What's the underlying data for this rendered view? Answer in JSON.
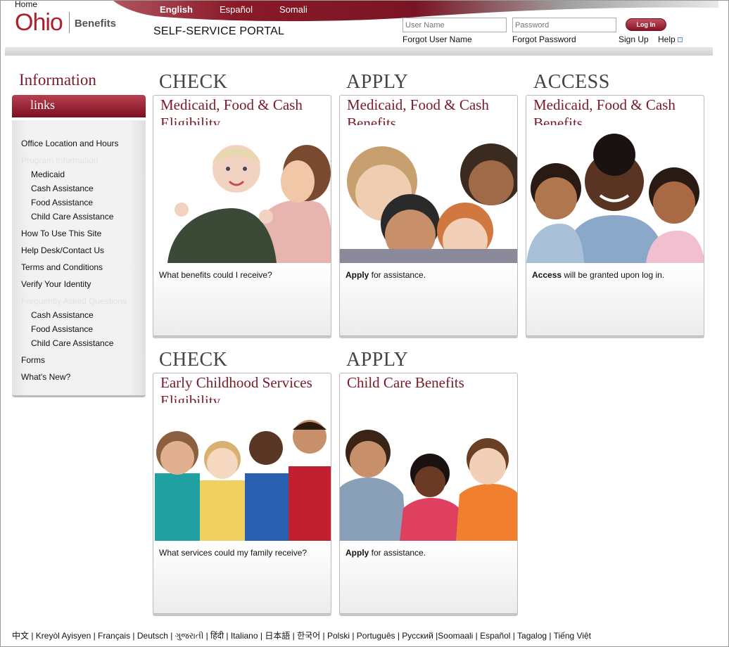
{
  "header": {
    "home": "Home",
    "logo_ohio": "Ohio",
    "logo_benefits": "Benefits",
    "portal_title": "SELF-SERVICE PORTAL",
    "languages": [
      "English",
      "Español",
      "Somali"
    ],
    "username_placeholder": "User Name",
    "password_placeholder": "Password",
    "login_label": "Log In",
    "forgot_username": "Forgot User Name",
    "forgot_password": "Forgot Password",
    "sign_up": "Sign Up",
    "help": "Help"
  },
  "sidebar": {
    "title": "Information",
    "links_label": "links",
    "items": [
      {
        "label": "Office Location and Hours"
      },
      {
        "label": "Program Information"
      },
      {
        "label": "Medicaid"
      },
      {
        "label": "Cash Assistance"
      },
      {
        "label": "Food Assistance"
      },
      {
        "label": "Child Care Assistance"
      },
      {
        "label": "How To Use This Site"
      },
      {
        "label": "Help Desk/Contact Us"
      },
      {
        "label": "Terms and Conditions"
      },
      {
        "label": "Verify Your Identity"
      },
      {
        "label": "Frequently Asked Questions"
      },
      {
        "label": "Cash Assistance"
      },
      {
        "label": "Food Assistance"
      },
      {
        "label": "Child Care Assistance"
      },
      {
        "label": "Forms"
      },
      {
        "label": "What's New?"
      }
    ]
  },
  "cards": [
    {
      "section": "CHECK",
      "heading": "Medicaid, Food & Cash Eligibility",
      "text_bold": "",
      "text": "What benefits could I receive?",
      "photo": "mother-and-baby-photo"
    },
    {
      "section": "APPLY",
      "heading": "Medicaid, Food & Cash Benefits",
      "text_bold": "Apply",
      "text": " for assistance.",
      "photo": "group-of-kids-photo"
    },
    {
      "section": "ACCESS",
      "heading": "Medicaid, Food & Cash Benefits",
      "text_bold": "Access",
      "text": " will be granted upon log in.",
      "photo": "father-and-children-photo"
    },
    {
      "section": "CHECK",
      "heading": "Early Childhood Services Eligibility",
      "text_bold": "",
      "text": "What services could my family receive?",
      "photo": "four-kids-photo"
    },
    {
      "section": "APPLY",
      "heading": "Child Care Benefits",
      "text_bold": "Apply",
      "text": " for assistance.",
      "photo": "three-kids-lying-photo"
    }
  ],
  "footer": {
    "languages": "中文 | Kreyòl Ayisyen | Français | Deutsch | ગુજરાતી | हिंदी | Italiano | 日本語 | 한국어 | Polski | Português | Русский |Soomaali | Español | Tagalog | Tiếng Việt"
  },
  "colors": {
    "brand": "#7a1a28",
    "logo_red": "#b01e2a"
  }
}
